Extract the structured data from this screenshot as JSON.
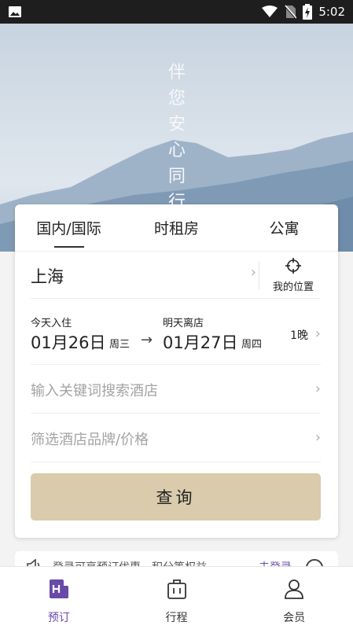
{
  "status_bar": {
    "time": "5:02",
    "icons": [
      "image-icon",
      "wifi-icon",
      "no-sim-icon",
      "battery-charging-icon"
    ]
  },
  "hero": {
    "slogan": [
      "伴",
      "您",
      "安",
      "心",
      "同",
      "行"
    ]
  },
  "tabs": [
    {
      "label": "国内/国际",
      "active": true
    },
    {
      "label": "时租房",
      "active": false
    },
    {
      "label": "公寓",
      "active": false
    }
  ],
  "city": {
    "name": "上海",
    "location_label": "我的位置"
  },
  "dates": {
    "checkin_label": "今天入住",
    "checkin_date": "01月26日",
    "checkin_weekday": "周三",
    "arrow": "→",
    "checkout_label": "明天离店",
    "checkout_date": "01月27日",
    "checkout_weekday": "周四",
    "nights": "1晚"
  },
  "keyword": {
    "placeholder": "输入关键词搜索酒店"
  },
  "brand": {
    "placeholder": "筛选酒店品牌/价格"
  },
  "search_button": {
    "label": "查询"
  },
  "notice": {
    "text": "登录可享预订优惠，积分等权益",
    "link": "去登录"
  },
  "bottom_nav": [
    {
      "label": "预订",
      "icon": "hotel-booking-icon",
      "active": true
    },
    {
      "label": "行程",
      "icon": "luggage-icon",
      "active": false
    },
    {
      "label": "会员",
      "icon": "user-icon",
      "active": false
    }
  ],
  "colors": {
    "accent": "#6a4aa8",
    "button": "#d9cbab",
    "placeholder": "#a3a3a3"
  }
}
